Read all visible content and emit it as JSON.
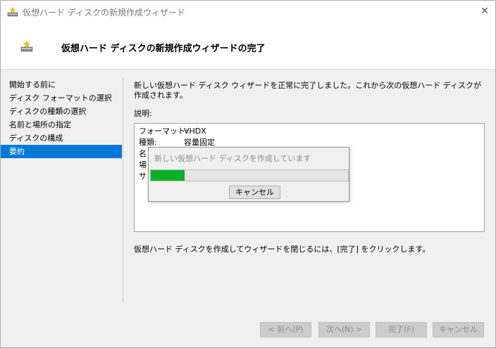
{
  "window": {
    "title": "仮想ハード ディスクの新規作成ウィザード",
    "close_glyph": "✕"
  },
  "header": {
    "title": "仮想ハード ディスクの新規作成ウィザードの完了"
  },
  "nav": {
    "items": [
      {
        "label": "開始する前に",
        "active": false
      },
      {
        "label": "ディスク フォーマットの選択",
        "active": false
      },
      {
        "label": "ディスクの種類の選択",
        "active": false
      },
      {
        "label": "名前と場所の指定",
        "active": false
      },
      {
        "label": "ディスクの構成",
        "active": false
      },
      {
        "label": "要約",
        "active": true
      }
    ]
  },
  "main": {
    "intro": "新しい仮想ハード ディスク ウィザードを正常に完了しました。これから次の仮想ハード ディスクが作成されます。",
    "description_label": "説明:",
    "summary": [
      {
        "key": "フォーマット:",
        "value": "VHDX"
      },
      {
        "key": "種類:",
        "value": "容量固定"
      },
      {
        "key": "名",
        "value": ""
      },
      {
        "key": "場",
        "value": ""
      },
      {
        "key": "サ",
        "value": ""
      }
    ],
    "finish_note": "仮想ハード ディスクを作成してウィザードを閉じるには、[完了] をクリックします。"
  },
  "progress": {
    "message": "新しい仮想ハード ディスクを作成しています",
    "fraction": 0.17,
    "cancel_label": "キャンセル",
    "fill_color": "#06b025"
  },
  "buttons": {
    "prev": "< 前へ(P)",
    "next": "次へ(N) >",
    "finish": "完了(F)",
    "cancel": "キャンセル"
  },
  "colors": {
    "accent": "#0078d7"
  },
  "icons": {
    "app": "hard-disk-icon",
    "header": "hard-disk-icon"
  }
}
